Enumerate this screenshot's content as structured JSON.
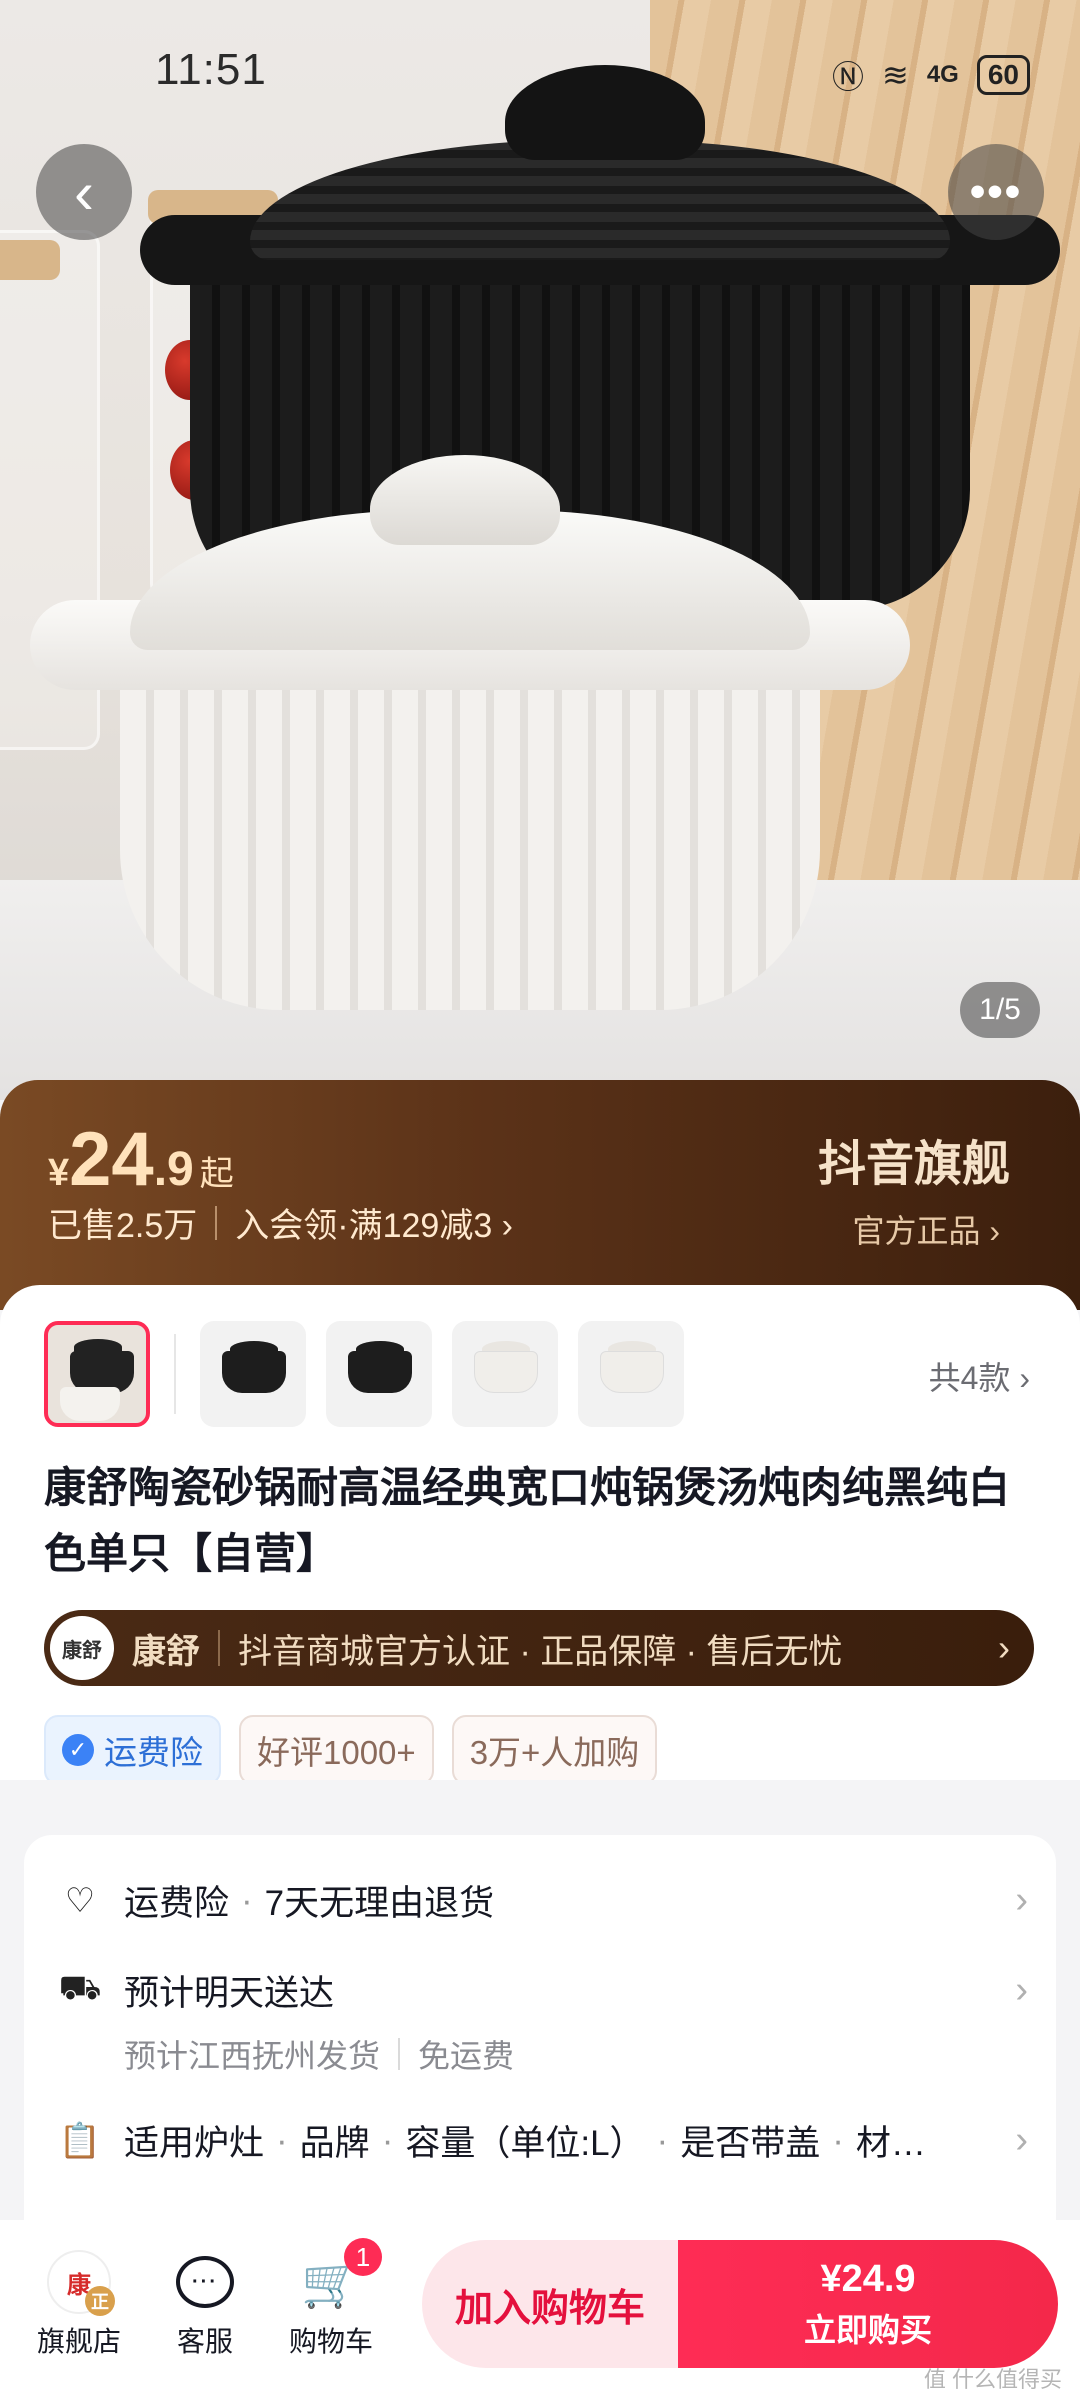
{
  "status_bar": {
    "time": "11:51",
    "network": "4G",
    "battery": "60"
  },
  "hero": {
    "image_counter": "1/5",
    "back_icon": "chevron-left-icon",
    "more_icon": "more-dots-icon"
  },
  "price_banner": {
    "currency": "¥",
    "price_int": "24",
    "price_dec": ".9",
    "price_suffix": "起",
    "sold": "已售2.5万",
    "promo": "入会领·满129减3 ›",
    "store_type": "抖音旗舰",
    "official": "官方正品 ›"
  },
  "variants": {
    "count_label": "共4款 ›"
  },
  "product": {
    "title": "康舒陶瓷砂锅耐高温经典宽口炖锅煲汤炖肉纯黑纯白色单只【自营】"
  },
  "shop": {
    "logo_text": "康舒",
    "name": "康舒",
    "certs": "抖音商城官方认证 · 正品保障 · 售后无忧",
    "arrow": "›"
  },
  "tags": [
    {
      "label": "运费险"
    },
    {
      "label": "好评1000+"
    },
    {
      "label": "3万+人加购"
    }
  ],
  "info": {
    "guarantee": {
      "a": "运费险",
      "b": "7天无理由退货",
      "arrow": "›"
    },
    "delivery": {
      "main": "预计明天送达",
      "origin": "预计江西抚州发货",
      "shipping": "免运费",
      "arrow": "›"
    },
    "params": {
      "items": [
        "适用炉灶",
        "品牌",
        "容量（单位:L）",
        "是否带盖",
        "材…"
      ],
      "arrow": "›"
    }
  },
  "bottom_bar": {
    "store_label": "旗舰店",
    "service_label": "客服",
    "cart_label": "购物车",
    "cart_count": "1",
    "add_to_cart": "加入购物车",
    "buy_price": "¥24.9",
    "buy_now": "立即购买"
  },
  "watermark": "值 什么值得买",
  "colors": {
    "accent": "#fe2c55",
    "banner_dark": "#3c1f0d",
    "price_gold": "#ffe2bb"
  }
}
